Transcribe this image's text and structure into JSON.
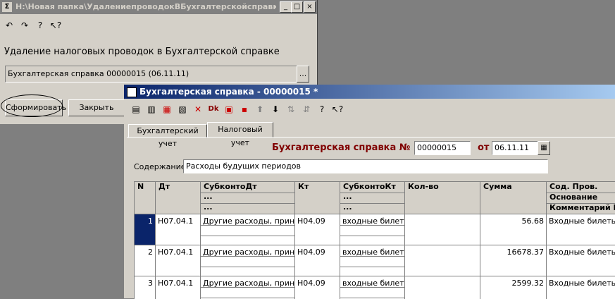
{
  "back_window": {
    "title": "H:\\Новая папка\\УдалениепроводокВБухгалтерскойсправке.ert",
    "heading": "Удаление налоговых проводок в Бухгалтерской справке",
    "doc_field_value": "Бухгалтерская справка 00000015 (06.11.11)",
    "select_button_label": "...",
    "form_button": "Сформировать",
    "close_button": "Закрыть",
    "controls": {
      "minimize": "_",
      "maximize": "□",
      "close": "×"
    }
  },
  "front_window": {
    "title": "Бухгалтерская справка - 00000015 *",
    "tabs": [
      "Бухгалтерский учет",
      "Налоговый учет"
    ],
    "active_tab": 1,
    "doc_label": "Бухгалтерская справка №",
    "doc_number": "00000015",
    "date_label": "от",
    "doc_date": "06.11.11",
    "content_label": "Содержание:",
    "content_value": "Расходы будущих периодов",
    "columns": {
      "n": "N",
      "dt": "Дт",
      "subdt": "СубконтоДт",
      "kt": "Кт",
      "subkt": "СубконтоКт",
      "qty": "Кол-во",
      "sum": "Сумма",
      "sod": "Сод. Пров.",
      "osn": "Основание",
      "comm": "Комментарий Н",
      "dots": "..."
    },
    "rows": [
      {
        "n": "1",
        "dt": "Н07.04.1",
        "subdt": "Другие расходы, приним",
        "kt": "Н04.09",
        "subkt": "входные билеты",
        "sum": "56.68",
        "sod": "Входные билеты"
      },
      {
        "n": "2",
        "dt": "Н07.04.1",
        "subdt": "Другие расходы, приним",
        "kt": "Н04.09",
        "subkt": "входные билеты",
        "sum": "16678.37",
        "sod": "Входные билеты"
      },
      {
        "n": "3",
        "dt": "Н07.04.1",
        "subdt": "Другие расходы, приним",
        "kt": "Н04.09",
        "subkt": "входные билеты",
        "sum": "2599.32",
        "sod": "Входные билеты"
      }
    ]
  },
  "colors": {
    "active_title": "#0a246a",
    "inactive_title": "#808080",
    "doc_label": "#800000",
    "selected_row": "#0a246a"
  },
  "icons": {
    "back_toolbar": [
      "undo-icon",
      "redo-icon",
      "help-icon",
      "context-help-icon"
    ],
    "front_toolbar": [
      "add-row-icon",
      "copy-row-icon",
      "delete-row-icon",
      "edit-icon",
      "delete-icon",
      "dt-kt-icon",
      "post-icon",
      "insert-icon",
      "move-up-icon",
      "move-down-icon",
      "sort-asc-icon",
      "sort-desc-icon",
      "help-icon",
      "context-help-icon"
    ]
  }
}
